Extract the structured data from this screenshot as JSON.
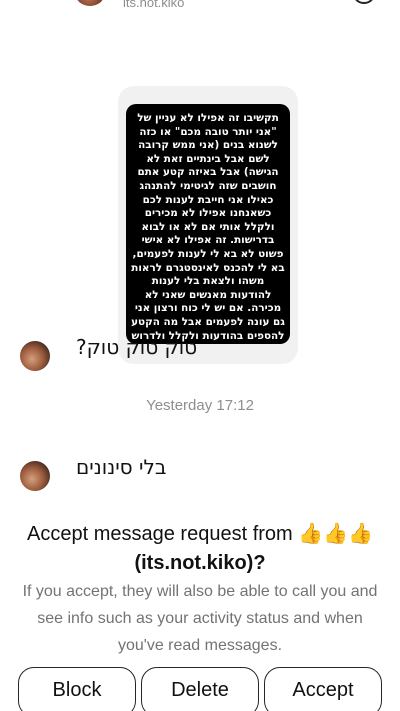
{
  "header": {
    "username": "its.not.kiko"
  },
  "story": {
    "text": "תקשיבו זה אפילו לא עניין של \"אני יותר טובה מכם\" או כזה לשנוא בנים (אני ממש קרובה לשם אבל בינתיים זאת לא הגישה) אבל באיזה קטע אתם חושבים שזה לגיטימי להתנהג כאילו אני חייבת לענות לכם כשאנחנו אפילו לא מכירים ולקלל אותי אם לא או לבוא בדרישות. זה אפילו לא אישי פשוט לא בא לי לענות לפעמים, בא לי להכנס לאינסטגרם לראות משהו ולצאת בלי לענות להודעות מאנשים שאני לא מכירה. אם יש לי כוח ורצון אני גם עונה לפעמים אבל מה הקטע להספים בהודעות ולקלל ולדרוש זאת התנהגות ממש לא נעימה אנשים תתאפסו על עצמכם"
  },
  "messages": [
    {
      "text": "טוק טוק טוק?"
    },
    {
      "text": "בלי סינונים"
    }
  ],
  "timestamp": "Yesterday 17:12",
  "request": {
    "title_prefix": "Accept message request from",
    "title_emoji": "👍👍👍",
    "username_line": "(its.not.kiko)?",
    "description": "If you accept, they will also be able to call you and see info such as your activity status and when you've read messages."
  },
  "actions": {
    "block": "Block",
    "delete": "Delete",
    "accept": "Accept"
  }
}
